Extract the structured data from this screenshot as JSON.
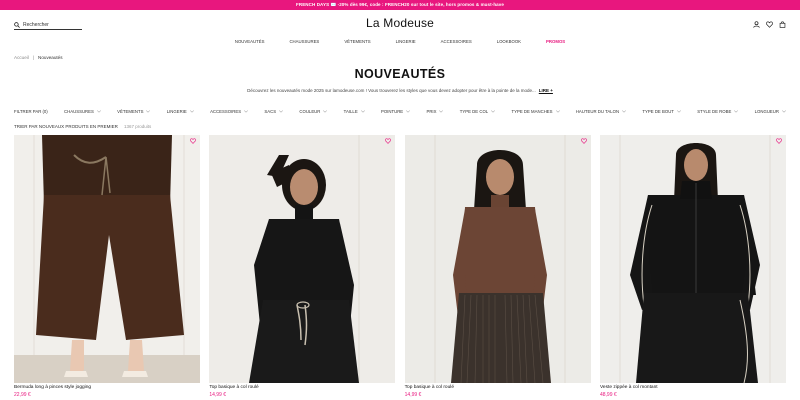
{
  "promo": {
    "text": "FRENCH DAYS ✉️ -20% dès 99€, code : FRENCH20 sur tout le site, hors promos & must-have"
  },
  "header": {
    "search_placeholder": "Rechercher",
    "logo": "La Modeuse",
    "icons": [
      "user-icon",
      "heart-icon",
      "bag-icon"
    ]
  },
  "nav": {
    "items": [
      {
        "label": "NOUVEAUTÉS"
      },
      {
        "label": "CHAUSSURES"
      },
      {
        "label": "VÊTEMENTS"
      },
      {
        "label": "LINGERIE"
      },
      {
        "label": "ACCESSOIRES"
      },
      {
        "label": "LOOKBOOK"
      },
      {
        "label": "PROMOS"
      }
    ],
    "promo_color": "#e8177e"
  },
  "breadcrumb": {
    "home": "Accueil",
    "sep": "|",
    "current": "Nouveautés"
  },
  "page": {
    "title": "NOUVEAUTÉS",
    "intro": "Découvrez les nouveautés mode 2025 sur lamodeuse.com ! Vous trouverez les styles que vous devez adopter pour être à la pointe de la mode...",
    "more": "LIRE +"
  },
  "filters": [
    {
      "label": "FILTRER PAR (0)"
    },
    {
      "label": "CHAUSSURES"
    },
    {
      "label": "VÊTEMENTS"
    },
    {
      "label": "LINGERIE"
    },
    {
      "label": "ACCESSOIRES"
    },
    {
      "label": "SACS"
    },
    {
      "label": "COULEUR"
    },
    {
      "label": "TAILLE"
    },
    {
      "label": "POINTURE"
    },
    {
      "label": "PRIX"
    },
    {
      "label": "TYPE DE COL"
    },
    {
      "label": "TYPE DE MANCHES"
    },
    {
      "label": "HAUTEUR DU TALON"
    },
    {
      "label": "TYPE DE BOUT"
    },
    {
      "label": "STYLE DE ROBE"
    },
    {
      "label": "LONGUEUR"
    }
  ],
  "sort": {
    "label": "TRIER PAR NOUVEAUX PRODUITS EN PREMIER",
    "count": "1367 produits"
  },
  "products": [
    {
      "name": "Bermuda long à pinces style jogging",
      "price": "22,99 €"
    },
    {
      "name": "Top basique à col roulé",
      "price": "14,99 €"
    },
    {
      "name": "Top basique à col roulé",
      "price": "14,99 €"
    },
    {
      "name": "Veste zippée à col montant",
      "price": "48,99 €"
    }
  ],
  "colors": {
    "accent": "#e8177e"
  }
}
